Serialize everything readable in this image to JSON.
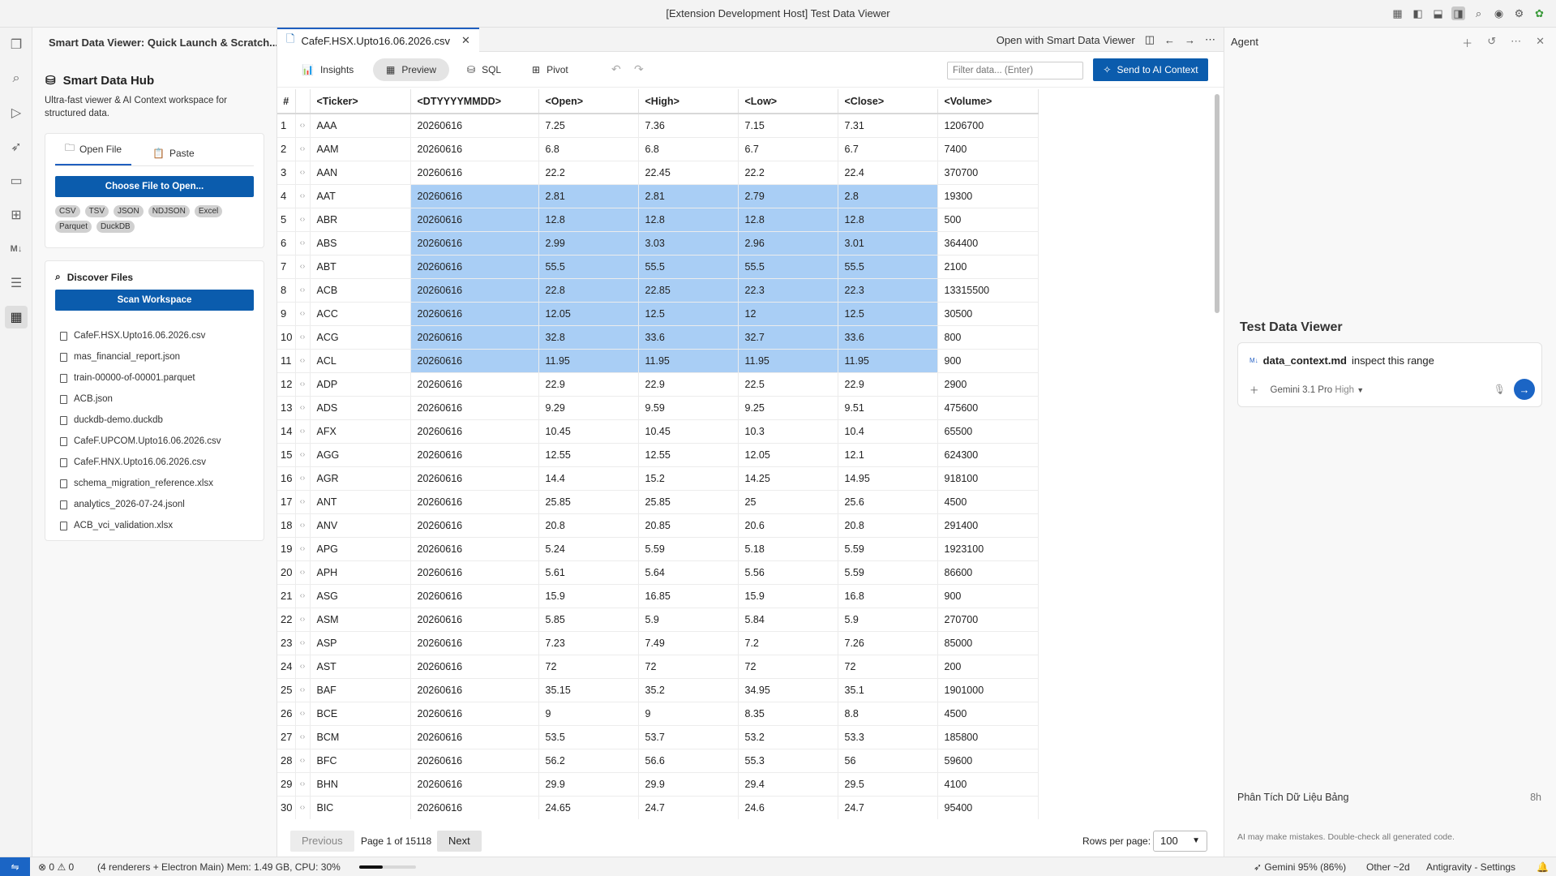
{
  "window": {
    "title": "[Extension Development Host] Test Data Viewer"
  },
  "sidebar": {
    "header": "Smart Data Viewer: Quick Launch & Scratch...",
    "hub_title": "Smart Data Hub",
    "hub_desc": "Ultra-fast viewer & AI Context workspace for structured data.",
    "tabs": {
      "open": "Open File",
      "paste": "Paste"
    },
    "choose_button": "Choose File to Open...",
    "formats": [
      "CSV",
      "TSV",
      "JSON",
      "NDJSON",
      "Excel",
      "Parquet",
      "DuckDB"
    ],
    "discover_title": "Discover Files",
    "scan_button": "Scan Workspace",
    "files": [
      "CafeF.HSX.Upto16.06.2026.csv",
      "mas_financial_report.json",
      "train-00000-of-00001.parquet",
      "ACB.json",
      "duckdb-demo.duckdb",
      "CafeF.UPCOM.Upto16.06.2026.csv",
      "CafeF.HNX.Upto16.06.2026.csv",
      "schema_migration_reference.xlsx",
      "analytics_2026-07-24.jsonl",
      "ACB_vci_validation.xlsx"
    ]
  },
  "editor": {
    "tab_label": "CafeF.HSX.Upto16.06.2026.csv",
    "open_with": "Open with Smart Data Viewer",
    "toolbar": {
      "insights": "Insights",
      "preview": "Preview",
      "sql": "SQL",
      "pivot": "Pivot",
      "send": "Send to AI Context"
    },
    "filter_placeholder": "Filter data... (Enter)",
    "columns": [
      "#",
      "",
      "<Ticker>",
      "<DTYYYYMMDD>",
      "<Open>",
      "<High>",
      "<Low>",
      "<Close>",
      "<Volume>"
    ],
    "selected_rows": [
      4,
      5,
      6,
      7,
      8,
      9,
      10,
      11
    ],
    "rows": [
      [
        "AAA",
        "20260616",
        "7.25",
        "7.36",
        "7.15",
        "7.31",
        "1206700"
      ],
      [
        "AAM",
        "20260616",
        "6.8",
        "6.8",
        "6.7",
        "6.7",
        "7400"
      ],
      [
        "AAN",
        "20260616",
        "22.2",
        "22.45",
        "22.2",
        "22.4",
        "370700"
      ],
      [
        "AAT",
        "20260616",
        "2.81",
        "2.81",
        "2.79",
        "2.8",
        "19300"
      ],
      [
        "ABR",
        "20260616",
        "12.8",
        "12.8",
        "12.8",
        "12.8",
        "500"
      ],
      [
        "ABS",
        "20260616",
        "2.99",
        "3.03",
        "2.96",
        "3.01",
        "364400"
      ],
      [
        "ABT",
        "20260616",
        "55.5",
        "55.5",
        "55.5",
        "55.5",
        "2100"
      ],
      [
        "ACB",
        "20260616",
        "22.8",
        "22.85",
        "22.3",
        "22.3",
        "13315500"
      ],
      [
        "ACC",
        "20260616",
        "12.05",
        "12.5",
        "12",
        "12.5",
        "30500"
      ],
      [
        "ACG",
        "20260616",
        "32.8",
        "33.6",
        "32.7",
        "33.6",
        "800"
      ],
      [
        "ACL",
        "20260616",
        "11.95",
        "11.95",
        "11.95",
        "11.95",
        "900"
      ],
      [
        "ADP",
        "20260616",
        "22.9",
        "22.9",
        "22.5",
        "22.9",
        "2900"
      ],
      [
        "ADS",
        "20260616",
        "9.29",
        "9.59",
        "9.25",
        "9.51",
        "475600"
      ],
      [
        "AFX",
        "20260616",
        "10.45",
        "10.45",
        "10.3",
        "10.4",
        "65500"
      ],
      [
        "AGG",
        "20260616",
        "12.55",
        "12.55",
        "12.05",
        "12.1",
        "624300"
      ],
      [
        "AGR",
        "20260616",
        "14.4",
        "15.2",
        "14.25",
        "14.95",
        "918100"
      ],
      [
        "ANT",
        "20260616",
        "25.85",
        "25.85",
        "25",
        "25.6",
        "4500"
      ],
      [
        "ANV",
        "20260616",
        "20.8",
        "20.85",
        "20.6",
        "20.8",
        "291400"
      ],
      [
        "APG",
        "20260616",
        "5.24",
        "5.59",
        "5.18",
        "5.59",
        "1923100"
      ],
      [
        "APH",
        "20260616",
        "5.61",
        "5.64",
        "5.56",
        "5.59",
        "86600"
      ],
      [
        "ASG",
        "20260616",
        "15.9",
        "16.85",
        "15.9",
        "16.8",
        "900"
      ],
      [
        "ASM",
        "20260616",
        "5.85",
        "5.9",
        "5.84",
        "5.9",
        "270700"
      ],
      [
        "ASP",
        "20260616",
        "7.23",
        "7.49",
        "7.2",
        "7.26",
        "85000"
      ],
      [
        "AST",
        "20260616",
        "72",
        "72",
        "72",
        "72",
        "200"
      ],
      [
        "BAF",
        "20260616",
        "35.15",
        "35.2",
        "34.95",
        "35.1",
        "1901000"
      ],
      [
        "BCE",
        "20260616",
        "9",
        "9",
        "8.35",
        "8.8",
        "4500"
      ],
      [
        "BCM",
        "20260616",
        "53.5",
        "53.7",
        "53.2",
        "53.3",
        "185800"
      ],
      [
        "BFC",
        "20260616",
        "56.2",
        "56.6",
        "55.3",
        "56",
        "59600"
      ],
      [
        "BHN",
        "20260616",
        "29.9",
        "29.9",
        "29.4",
        "29.5",
        "4100"
      ],
      [
        "BIC",
        "20260616",
        "24.65",
        "24.7",
        "24.6",
        "24.7",
        "95400"
      ]
    ],
    "pager": {
      "prev": "Previous",
      "info": "Page 1 of 15118",
      "next": "Next",
      "rows_per_page_label": "Rows per page:",
      "rows_per_page": "100"
    }
  },
  "agent": {
    "header": "Agent",
    "title": "Test Data Viewer",
    "context_badge": "M↓",
    "context_file": "data_context.md",
    "message": "inspect this range",
    "model": "Gemini 3.1 Pro",
    "model_level": "High",
    "history_item": "Phân Tích Dữ Liệu Bảng",
    "history_time": "8h",
    "disclaimer": "AI may make mistakes. Double-check all generated code."
  },
  "statusbar": {
    "errors": "0",
    "warnings": "0",
    "mem": "(4 renderers + Electron Main) Mem: 1.49 GB, CPU: 30%",
    "mem_fraction": 0.42,
    "gemini": "Gemini 95% (86%)",
    "other": "Other ~2d",
    "settings": "Antigravity - Settings"
  },
  "colors": {
    "accent": "#0b5cad",
    "selection": "#a9cef5"
  }
}
